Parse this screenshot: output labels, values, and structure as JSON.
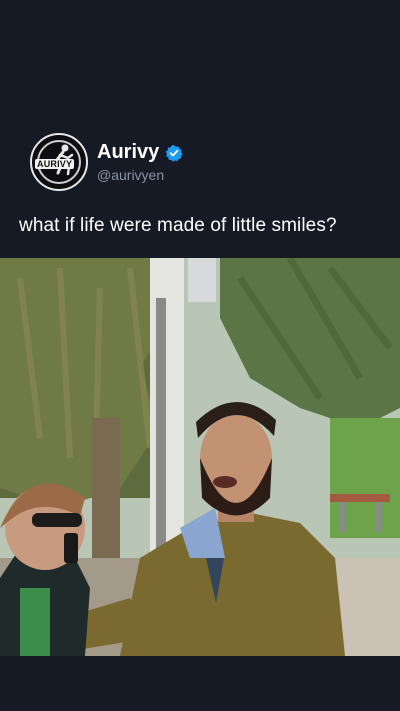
{
  "account": {
    "display_name": "Aurivy",
    "handle": "@aurivyen",
    "verified": true,
    "logo_text": "AURIVY",
    "badge_color": "#1d9bf0"
  },
  "post": {
    "caption": "what if life were made of little smiles?"
  },
  "theme": {
    "background": "#151a24",
    "text": "#ffffff",
    "muted": "#8a93a3"
  }
}
